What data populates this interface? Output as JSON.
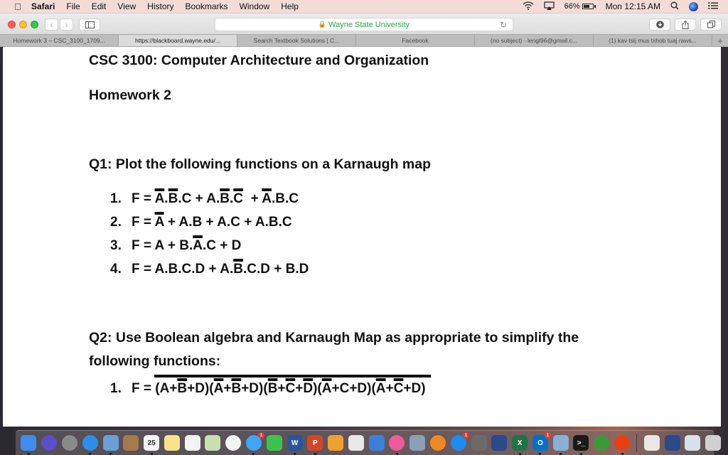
{
  "menubar": {
    "apple_icon": "apple-logo",
    "app_name": "Safari",
    "items": [
      "File",
      "Edit",
      "View",
      "History",
      "Bookmarks",
      "Window",
      "Help"
    ],
    "battery_percent": "66%",
    "battery_level": 0.66,
    "clock": "Mon 12:15 AM"
  },
  "toolbar": {
    "address_text": "Wayne State University",
    "back_glyph": "‹",
    "forward_glyph": "›",
    "reload_glyph": "↻"
  },
  "tabs": [
    {
      "label": "Homework 3 – CSC_3100_1709...",
      "active": false
    },
    {
      "label": "https://blackboard.wayne.edu/...",
      "active": true
    },
    {
      "label": "Search Textbook Solutions | C...",
      "active": false
    },
    {
      "label": "Facebook",
      "active": false
    },
    {
      "label": "(no subject) - lengl96@gmail.c...",
      "active": false
    },
    {
      "label": "(1) kav tsij mus txhob tuaj raws...",
      "active": false
    }
  ],
  "tab_add": "+",
  "document": {
    "course_title": "CSC 3100: Computer Architecture and Organization",
    "homework_title": "Homework 2",
    "q1": {
      "prompt": "Q1: Plot the following functions on a Karnaugh map",
      "items": [
        {
          "num": "1.",
          "parts": [
            [
              "F = ",
              false
            ],
            [
              "A",
              true
            ],
            [
              ".",
              false
            ],
            [
              "B",
              true
            ],
            [
              ".C + A.",
              false
            ],
            [
              "B",
              true
            ],
            [
              ".",
              false
            ],
            [
              "C",
              true
            ],
            [
              "  + ",
              false
            ],
            [
              "A",
              true
            ],
            [
              ".B.C",
              false
            ]
          ]
        },
        {
          "num": "2.",
          "parts": [
            [
              "F = ",
              false
            ],
            [
              "A",
              true
            ],
            [
              " + A.B + A.C + A.B.C",
              false
            ]
          ]
        },
        {
          "num": "3.",
          "parts": [
            [
              "F = A + B.",
              false
            ],
            [
              "A",
              true
            ],
            [
              ".C + D",
              false
            ]
          ]
        },
        {
          "num": "4.",
          "parts": [
            [
              "F = A.B.C.D + A.",
              false
            ],
            [
              "B",
              true
            ],
            [
              ".C.D + B.D",
              false
            ]
          ]
        }
      ]
    },
    "q2": {
      "prompt_line1": "Q2: Use Boolean algebra and Karnaugh Map as appropriate to simplify the",
      "prompt_line2": "following functions:",
      "items": [
        {
          "num": "1.",
          "parts": [
            [
              "F = (A+",
              false
            ],
            [
              "B",
              true
            ],
            [
              "+D)(",
              false
            ],
            [
              "A",
              true
            ],
            [
              "+",
              false
            ],
            [
              "B",
              true
            ],
            [
              "+D)(",
              false
            ],
            [
              "B",
              true
            ],
            [
              "+",
              false
            ],
            [
              "C",
              true
            ],
            [
              "+",
              false
            ],
            [
              "D",
              true
            ],
            [
              ")(",
              false
            ],
            [
              "A",
              true
            ],
            [
              "+C+D)(",
              false
            ],
            [
              "A",
              true
            ],
            [
              "+",
              false
            ],
            [
              "C",
              true
            ],
            [
              "+D)",
              false
            ]
          ]
        }
      ]
    }
  },
  "dock": {
    "apps": [
      {
        "name": "finder",
        "color": "#3d8ef0",
        "running": true
      },
      {
        "name": "siri",
        "color": "#5a4fc8",
        "round": true
      },
      {
        "name": "launchpad",
        "color": "#8a8a8a",
        "round": true
      },
      {
        "name": "safari",
        "color": "#2d8ee8",
        "round": true,
        "running": true
      },
      {
        "name": "preview",
        "color": "#6aa0d8",
        "running": true
      },
      {
        "name": "contacts",
        "color": "#a77a4a"
      },
      {
        "name": "calendar",
        "color": "#f7f7f7",
        "label": "25",
        "running": true
      },
      {
        "name": "notes",
        "color": "#f7e48a"
      },
      {
        "name": "reminders",
        "color": "#f4f4f4"
      },
      {
        "name": "maps",
        "color": "#c8e0b0"
      },
      {
        "name": "photos",
        "color": "#f4f4f4",
        "round": true
      },
      {
        "name": "messages",
        "color": "#3fa5f6",
        "round": true,
        "badge": "1",
        "running": true
      },
      {
        "name": "facetime",
        "color": "#3cc44a"
      },
      {
        "name": "word",
        "color": "#2b579a",
        "label": "W",
        "running": true
      },
      {
        "name": "powerpoint",
        "color": "#d24726",
        "label": "P",
        "running": true
      },
      {
        "name": "pages",
        "color": "#f0a030"
      },
      {
        "name": "numbers",
        "color": "#e8e8e8"
      },
      {
        "name": "keynote",
        "color": "#3a80d8"
      },
      {
        "name": "itunes",
        "color": "#f05a9a",
        "round": true,
        "running": true
      },
      {
        "name": "image-capture",
        "color": "#8aa0b8"
      },
      {
        "name": "ibooks",
        "color": "#f08a20",
        "round": true
      },
      {
        "name": "app-store",
        "color": "#1b8cf0",
        "round": true,
        "badge": "1"
      },
      {
        "name": "system-preferences",
        "color": "#6a6a6a"
      },
      {
        "name": "virtualbox",
        "color": "#2a4a8a"
      },
      {
        "name": "excel",
        "color": "#217346",
        "label": "X",
        "running": true
      },
      {
        "name": "outlook",
        "color": "#0072c6",
        "label": "O",
        "badge": "1",
        "running": true
      },
      {
        "name": "virtualbox-vm",
        "color": "#88b0d8",
        "running": true
      },
      {
        "name": "terminal",
        "color": "#1a1a1a",
        "label": ">_",
        "running": true
      },
      {
        "name": "remote-desktop",
        "color": "#3a9a3a",
        "round": true
      },
      {
        "name": "office-installer",
        "color": "#e84010",
        "round": true,
        "running": true
      }
    ],
    "others": [
      {
        "name": "document-stack",
        "color": "#e8e8e8"
      },
      {
        "name": "virtualbox-stack",
        "color": "#2a4a8a"
      },
      {
        "name": "screenshot-stack",
        "color": "#d8e0ea"
      },
      {
        "name": "trash",
        "color": "#d0d0d0"
      }
    ]
  }
}
